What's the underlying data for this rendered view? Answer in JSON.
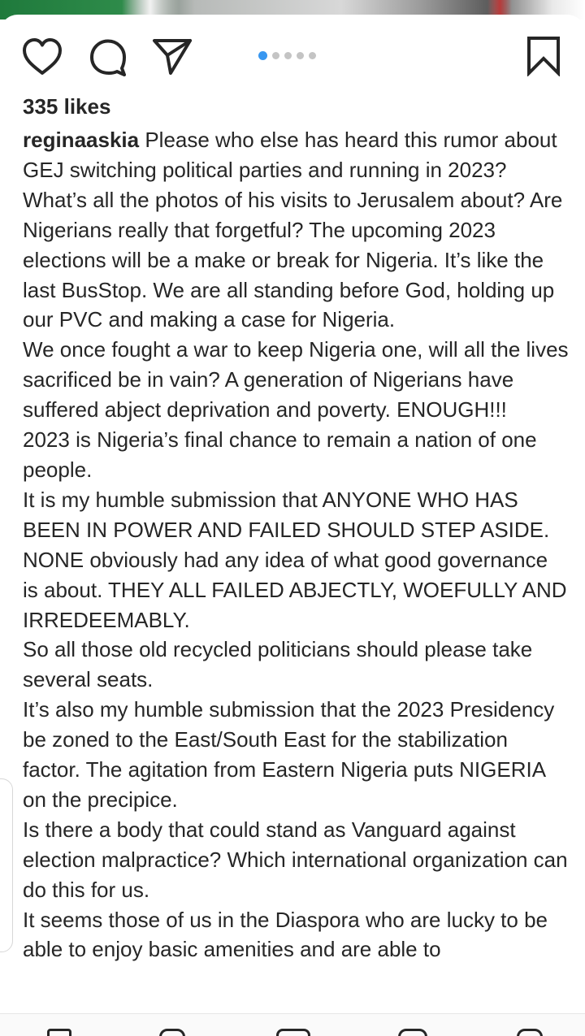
{
  "post": {
    "likes": "335 likes",
    "username": "reginaaskia",
    "caption_first": "Please who else has heard this rumor about GEJ switching political parties and running in 2023? What’s all the photos of his visits to Jerusalem about? Are Nigerians really that forgetful? The upcoming 2023 elections will be a make or break for Nigeria. It’s like the last BusStop. We are all standing before God, holding up our PVC and  making a case for Nigeria.",
    "paragraphs": [
      "We once fought a war to keep Nigeria one, will all the lives sacrificed be in vain? A generation of Nigerians have suffered  abject deprivation and poverty. ENOUGH!!!",
      "2023 is Nigeria’s final chance to remain a nation of one people.",
      "It is my humble submission that ANYONE WHO HAS BEEN IN POWER AND FAILED SHOULD STEP ASIDE. NONE obviously had any idea of what good governance is about. THEY ALL FAILED ABJECTLY, WOEFULLY AND IRREDEEMABLY.",
      "So all those old recycled politicians should please take several seats.",
      "It’s also my humble submission that the 2023 Presidency be zoned to the East/South East for the stabilization factor. The agitation from Eastern Nigeria puts NIGERIA on the precipice.",
      "Is there a body that could stand as Vanguard against election malpractice? Which international organization can do this for us.",
      "It seems those of us in the Diaspora who are lucky to be able to enjoy basic amenities and are able to"
    ]
  },
  "carousel": {
    "count": 5,
    "active_index": 0
  },
  "colors": {
    "accent": "#3897f0",
    "text": "#262626",
    "dot_inactive": "#c4c4c4"
  },
  "icons": {
    "like": "heart-outline-icon",
    "comment": "comment-bubble-icon",
    "share": "paper-plane-icon",
    "save": "bookmark-outline-icon"
  }
}
